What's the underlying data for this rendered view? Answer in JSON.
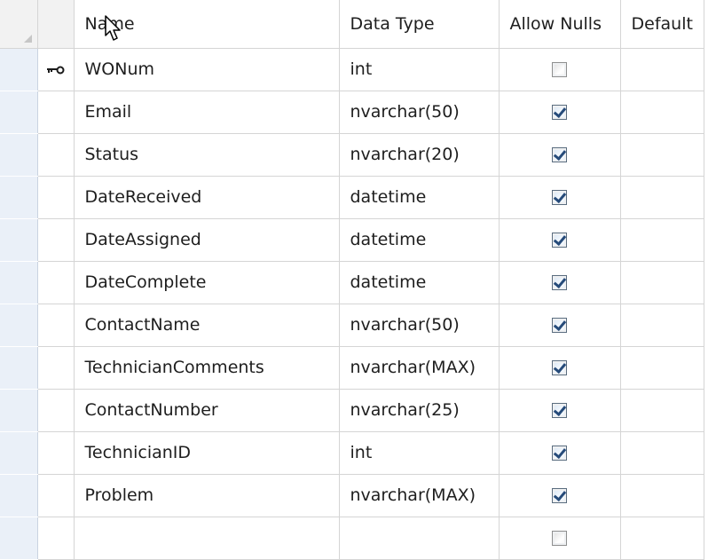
{
  "columns": {
    "name": "Name",
    "data_type": "Data Type",
    "allow_nulls": "Allow Nulls",
    "default": "Default"
  },
  "rows": [
    {
      "name": "WONum",
      "data_type": "int",
      "allow_nulls": false,
      "primary_key": true
    },
    {
      "name": "Email",
      "data_type": "nvarchar(50)",
      "allow_nulls": true
    },
    {
      "name": "Status",
      "data_type": "nvarchar(20)",
      "allow_nulls": true
    },
    {
      "name": "DateReceived",
      "data_type": "datetime",
      "allow_nulls": true
    },
    {
      "name": "DateAssigned",
      "data_type": "datetime",
      "allow_nulls": true
    },
    {
      "name": "DateComplete",
      "data_type": "datetime",
      "allow_nulls": true
    },
    {
      "name": "ContactName",
      "data_type": "nvarchar(50)",
      "allow_nulls": true
    },
    {
      "name": "TechnicianComments",
      "data_type": "nvarchar(MAX)",
      "allow_nulls": true
    },
    {
      "name": "ContactNumber",
      "data_type": "nvarchar(25)",
      "allow_nulls": true
    },
    {
      "name": "TechnicianID",
      "data_type": "int",
      "allow_nulls": true
    },
    {
      "name": "Problem",
      "data_type": "nvarchar(MAX)",
      "allow_nulls": true
    },
    {
      "name": "",
      "data_type": "",
      "allow_nulls": false
    }
  ],
  "icons": {
    "primary_key": "key-icon",
    "cursor": "mouse-pointer-icon"
  }
}
